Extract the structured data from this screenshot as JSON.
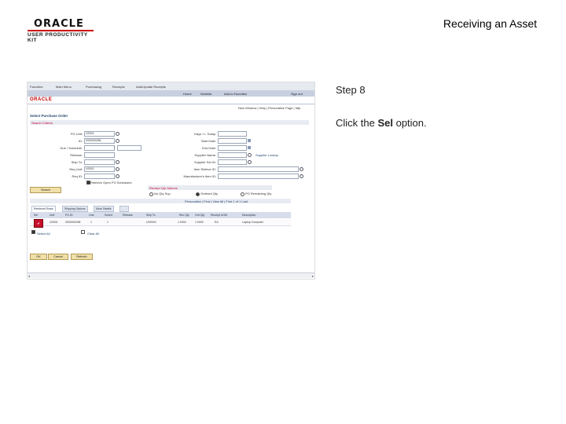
{
  "slide": {
    "title": "Receiving an Asset",
    "logo": {
      "brand": "ORACLE",
      "product": "USER PRODUCTIVITY KIT"
    },
    "step": "Step 8",
    "instruction": {
      "prefix": "Click the ",
      "bold": "Sel",
      "suffix": " option."
    }
  },
  "screenshot": {
    "topnav": [
      "Favorites",
      "Main Menu",
      "Purchasing",
      "Receipts",
      "Add/Update Receipts"
    ],
    "navbar": [
      "Home",
      "Worklist",
      "Add to Favorites",
      "Sign out"
    ],
    "logo": "ORACLE",
    "util_links": "New Window | Help | Personalize Page | http",
    "page_title": "Select Purchase Order",
    "criteria_header": "Search Criteria",
    "left_fields": [
      {
        "label": "PO Unit:",
        "value": "US001"
      },
      {
        "label": "ID:",
        "value": "0000000256"
      },
      {
        "label": "Due / Schedule:",
        "value": ""
      },
      {
        "label": "Release:",
        "value": ""
      },
      {
        "label": "Ship To:",
        "value": ""
      },
      {
        "label": "Req Unit:",
        "value": "US001"
      },
      {
        "label": "Req ID:",
        "value": ""
      }
    ],
    "right_fields": [
      {
        "label": "Days +/- Today:",
        "value": ""
      },
      {
        "label": "Start Date:",
        "value": ""
      },
      {
        "label": "End Date:",
        "value": ""
      },
      {
        "label": "Supplier Name:",
        "value": ""
      },
      {
        "label": "Supplier Set ID:",
        "value": ""
      },
      {
        "label": "Item Relieve ID:",
        "value": ""
      },
      {
        "label": "Manufacturer's Item ID:",
        "value": ""
      }
    ],
    "supplier_lookup": "Supplier Lookup",
    "retrieve_label": "Retrieve Open PO Schedules",
    "search_btn": "Search",
    "qty_options_header": "Receipt Qty Options",
    "qty_options": [
      "No Qty Sup",
      "Ordered Qty",
      "PO Remaining Qty"
    ],
    "grid_tabs": [
      "Retrieved Rows",
      "Shipping Options",
      "More Details"
    ],
    "grid_nav": "Personalize | Find | View All |  First  1 of 1  Last",
    "grid_headers": [
      "Sel",
      "Unit",
      "PO ID",
      "Line",
      "Sched",
      "Release",
      "Ship To",
      "Rec Qty",
      "Ord Qty",
      "Receipt UOM",
      "Description"
    ],
    "grid_row": {
      "sel": "✔",
      "unit": "US001",
      "po_id": "0000000256",
      "line": "1",
      "sched": "1",
      "release": "",
      "ship_to": "US0002",
      "rec_qty": "1.0000",
      "ord_qty": "1.0000",
      "uom": "EA",
      "description": "Laptop Computer"
    },
    "select_all": "Select All",
    "clear_all": "Clear All",
    "bottom_buttons": [
      "OK",
      "Cancel",
      "Refresh"
    ]
  }
}
